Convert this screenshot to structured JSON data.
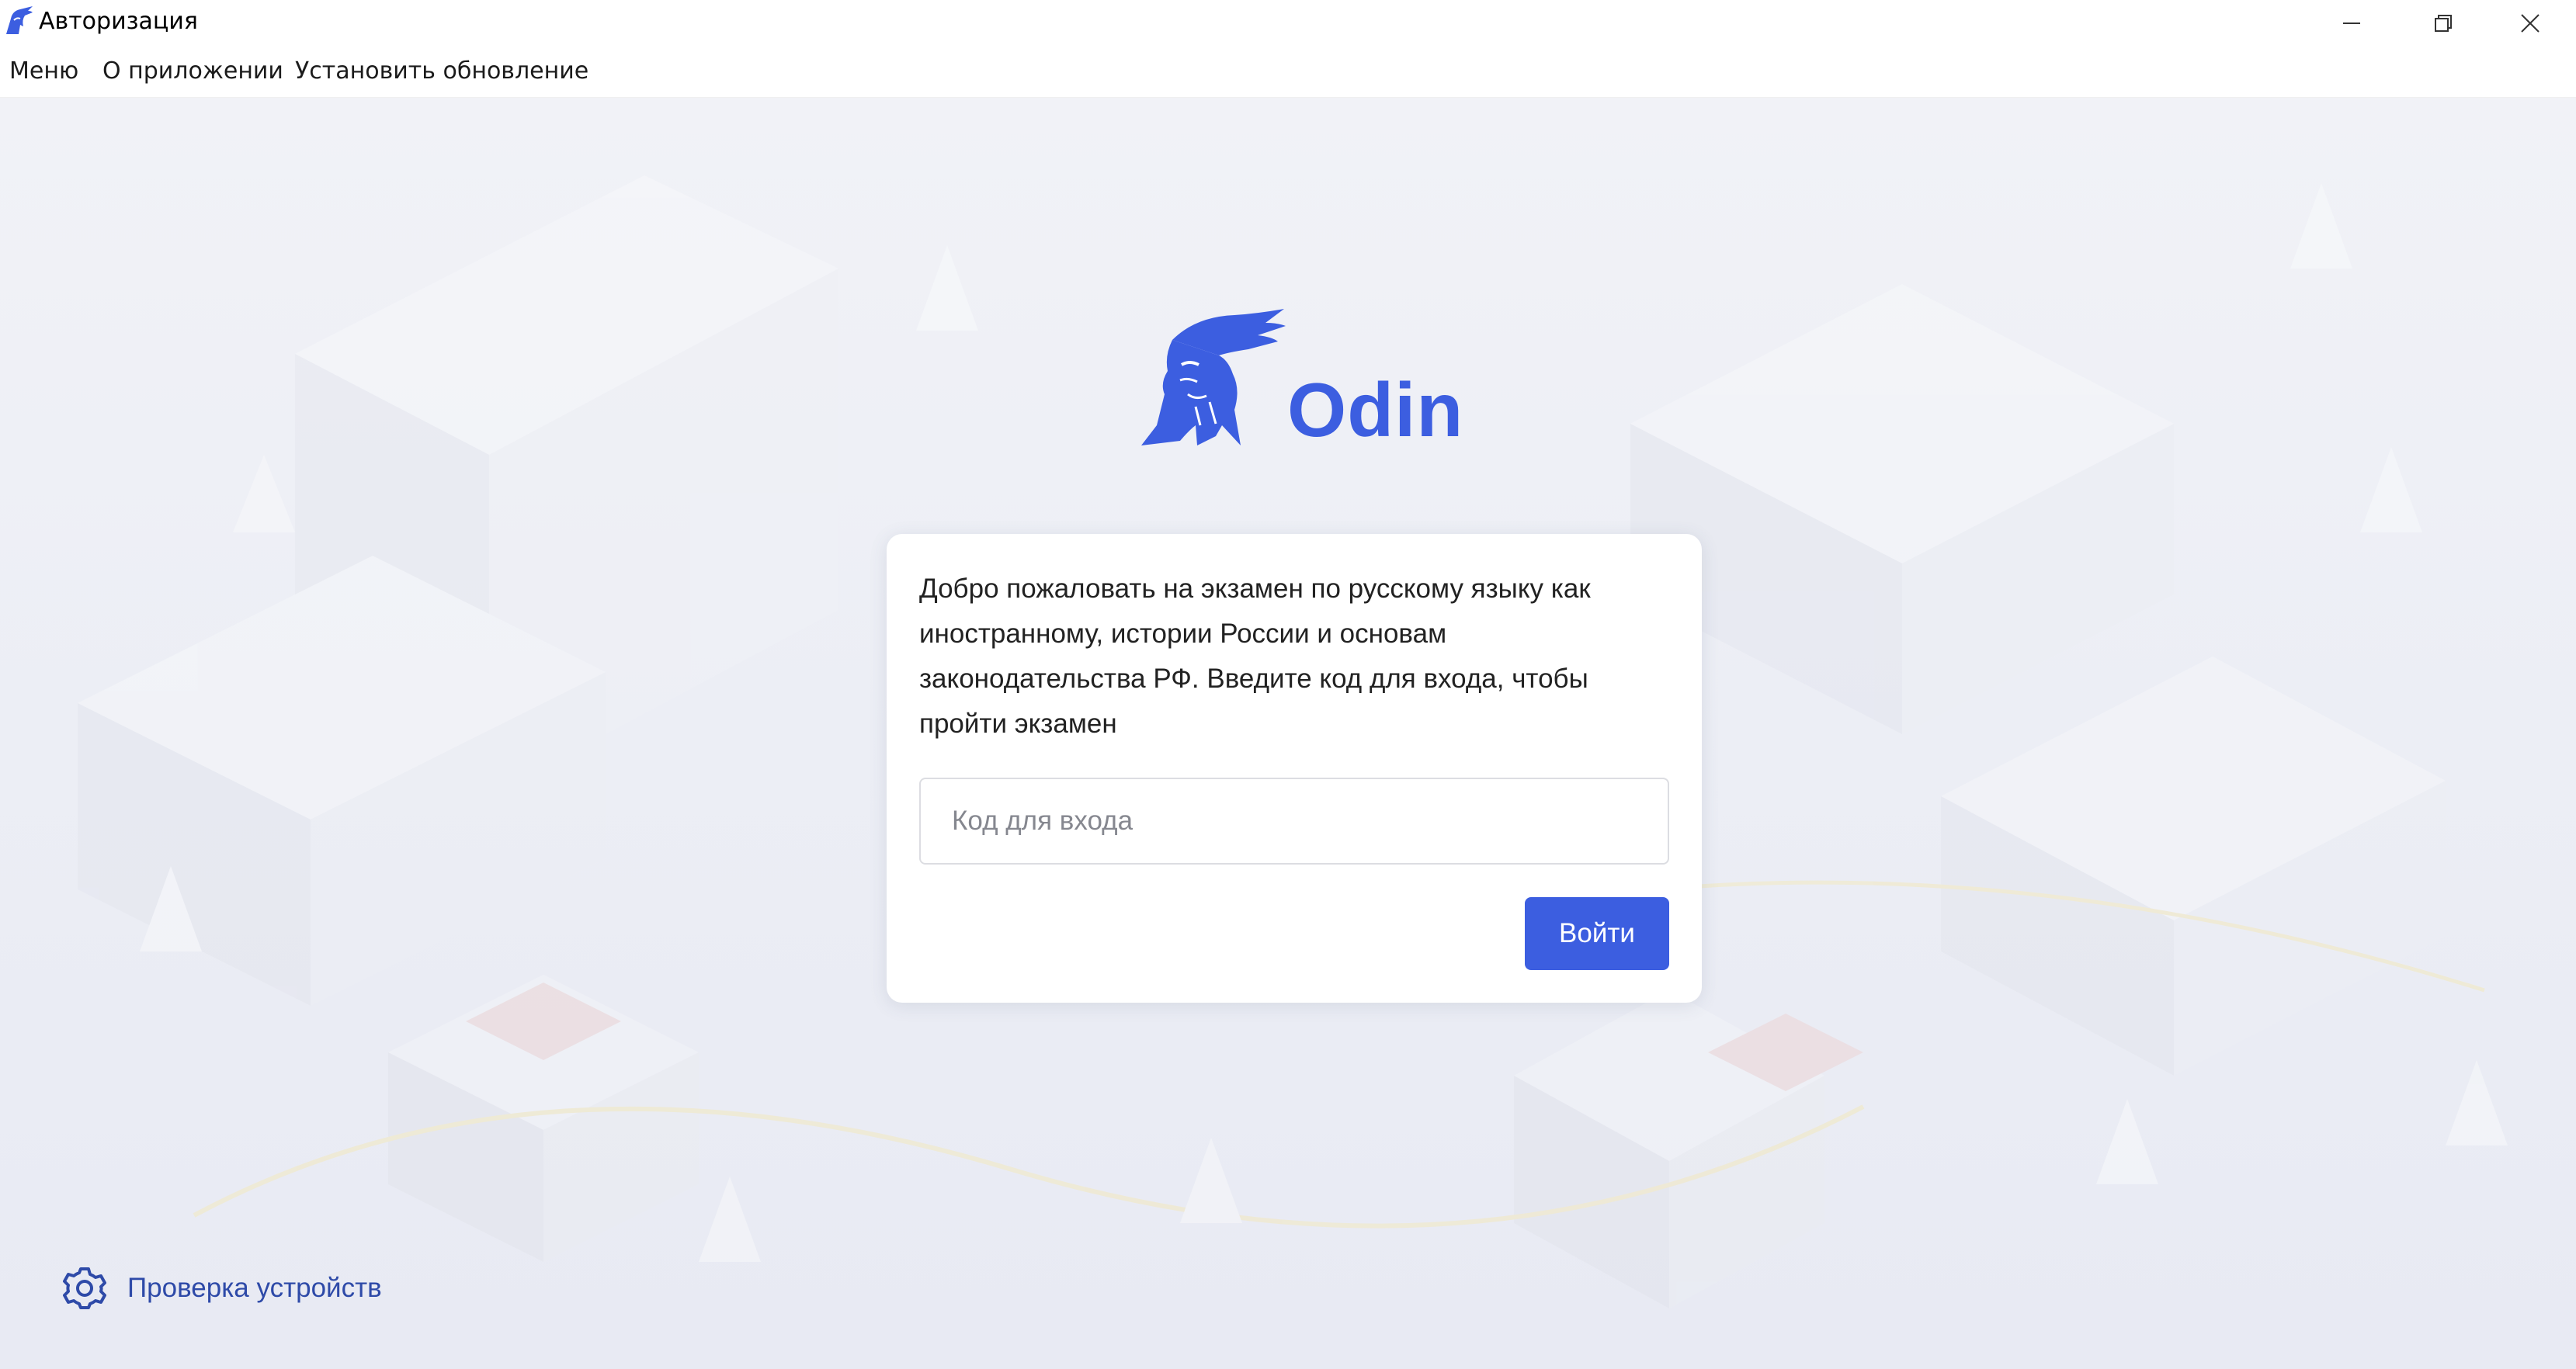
{
  "window": {
    "title": "Авторизация",
    "controls": [
      "minimize",
      "restore",
      "close"
    ]
  },
  "menubar": {
    "items": [
      {
        "label": "Меню"
      },
      {
        "label": "О приложении"
      },
      {
        "label": "Установить обновление"
      }
    ]
  },
  "logo": {
    "name": "Odin",
    "icon": "odin-head-icon"
  },
  "login": {
    "welcome_text": "Добро пожаловать на экзамен по русскому языку как иностранному, истории России и основам законодательства РФ. Введите код для входа, чтобы пройти экзамен",
    "code_placeholder": "Код для входа",
    "code_value": "",
    "submit_label": "Войти"
  },
  "footer": {
    "device_check_label": "Проверка устройств",
    "device_check_icon": "gear-icon"
  },
  "colors": {
    "accent": "#3c5ee0",
    "link": "#2e4aa8",
    "background": "#eceef5",
    "card": "#ffffff"
  }
}
